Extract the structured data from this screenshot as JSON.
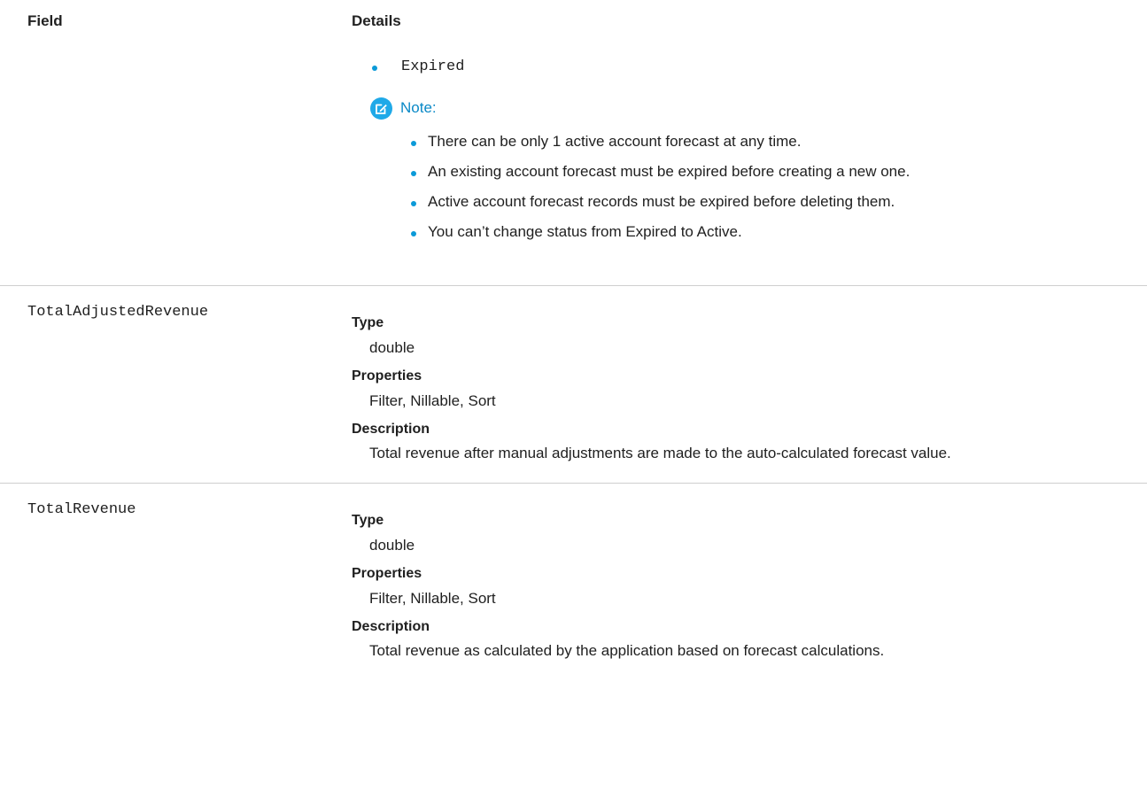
{
  "header": {
    "field_label": "Field",
    "details_label": "Details"
  },
  "status_continuation": {
    "bullet_value": "Expired",
    "note": {
      "title": "Note:",
      "items": [
        "There can be only 1 active account forecast at any time.",
        "An existing account forecast must be expired before creating a new one.",
        "Active account forecast records must be expired before deleting them.",
        "You can’t change status from Expired to Active."
      ]
    }
  },
  "rows": [
    {
      "field": "TotalAdjustedRevenue",
      "type_label": "Type",
      "type_value": "double",
      "properties_label": "Properties",
      "properties_value": "Filter, Nillable, Sort",
      "description_label": "Description",
      "description_value": "Total revenue after manual adjustments are made to the auto-calculated forecast value."
    },
    {
      "field": "TotalRevenue",
      "type_label": "Type",
      "type_value": "double",
      "properties_label": "Properties",
      "properties_value": "Filter, Nillable, Sort",
      "description_label": "Description",
      "description_value": "Total revenue as calculated by the application based on forecast calculations."
    }
  ],
  "colors": {
    "accent": "#1fa9e8",
    "note_title": "#0a89c7",
    "divider": "#cfcfcf"
  }
}
